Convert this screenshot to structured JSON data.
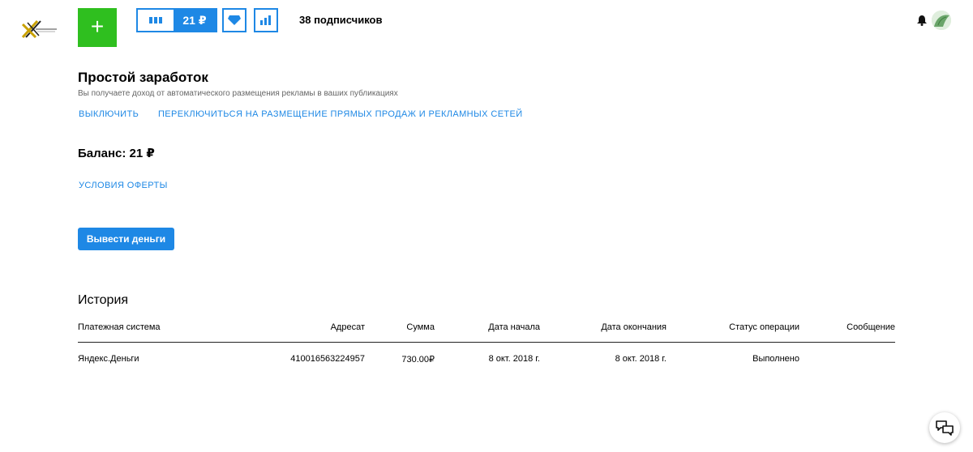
{
  "header": {
    "add_label": "+",
    "balance_label": "21 ₽",
    "subscribers": "38 подписчиков",
    "icons": {
      "logo": "logo-icon",
      "bars": "bars-icon",
      "diamond": "diamond-icon",
      "stats": "stats-icon",
      "bell": "bell-icon",
      "avatar": "avatar-icon"
    }
  },
  "main": {
    "title": "Простой заработок",
    "subtitle": "Вы получаете доход от автоматического размещения рекламы в ваших публикациях",
    "link_off": "Выключить",
    "link_switch": "Переключиться на размещение прямых продаж и рекламных сетей",
    "balance": "Баланс: 21 ₽",
    "link_terms": "Условия оферты",
    "withdraw_label": "Вывести деньги"
  },
  "history": {
    "title": "История",
    "columns": [
      "Платежная система",
      "Адресат",
      "Сумма",
      "Дата начала",
      "Дата окончания",
      "Статус операции",
      "Сообщение"
    ],
    "rows": [
      [
        "Яндекс.Деньги",
        "410016563224957",
        "730.00₽",
        "8 окт. 2018 г.",
        "8 окт. 2018 г.",
        "Выполнено",
        ""
      ]
    ]
  },
  "colors": {
    "accent": "#1e88e5",
    "add_button": "#2fbf1f"
  }
}
